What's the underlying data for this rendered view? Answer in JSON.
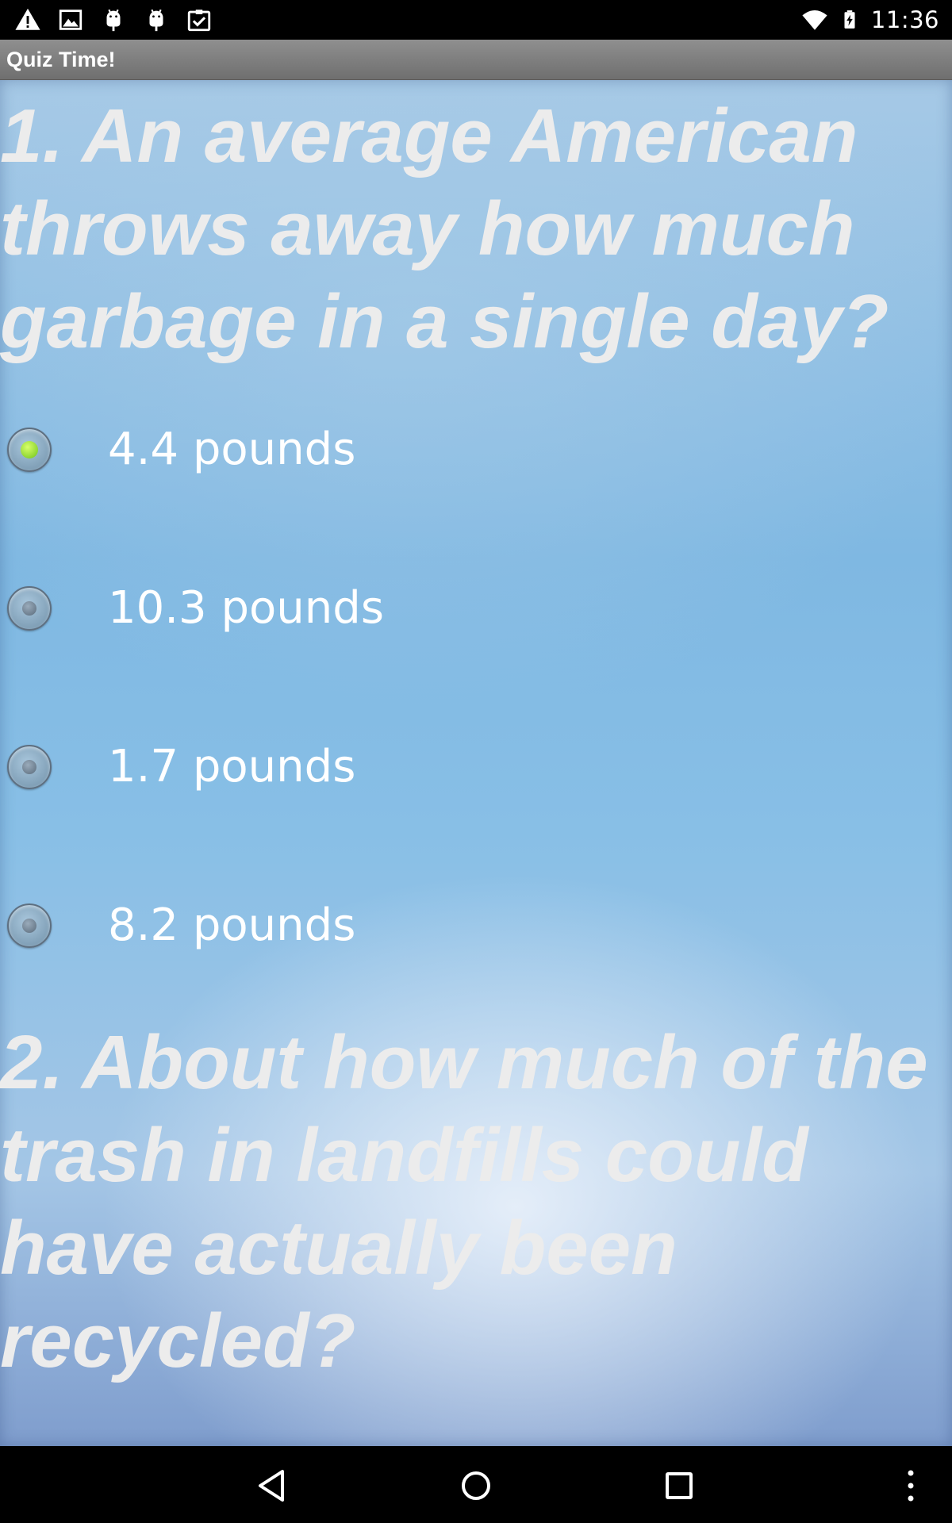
{
  "status_bar": {
    "time": "11:36",
    "left_icons": [
      "warning-icon",
      "image-icon",
      "android-icon",
      "android-icon",
      "clipboard-check-icon"
    ],
    "right_icons": [
      "wifi-icon",
      "battery-charging-icon"
    ]
  },
  "app": {
    "title": "Quiz Time!"
  },
  "quiz": {
    "questions": [
      {
        "text": "1. An average American throws away how much garbage in a single day?",
        "options": [
          {
            "label": "4.4 pounds",
            "selected": true
          },
          {
            "label": "10.3 pounds",
            "selected": false
          },
          {
            "label": "1.7 pounds",
            "selected": false
          },
          {
            "label": "8.2 pounds",
            "selected": false
          }
        ]
      },
      {
        "text": "2. About how much of the trash in landfills could have actually been recycled?"
      }
    ]
  },
  "nav_bar": {
    "buttons": [
      "back-icon",
      "home-icon",
      "recents-icon",
      "overflow-menu-icon"
    ]
  },
  "colors": {
    "selected_radio": "#6ec31b",
    "question_text": "#ececec",
    "option_text": "#ffffff",
    "title_bar": "#7f7f7f"
  }
}
